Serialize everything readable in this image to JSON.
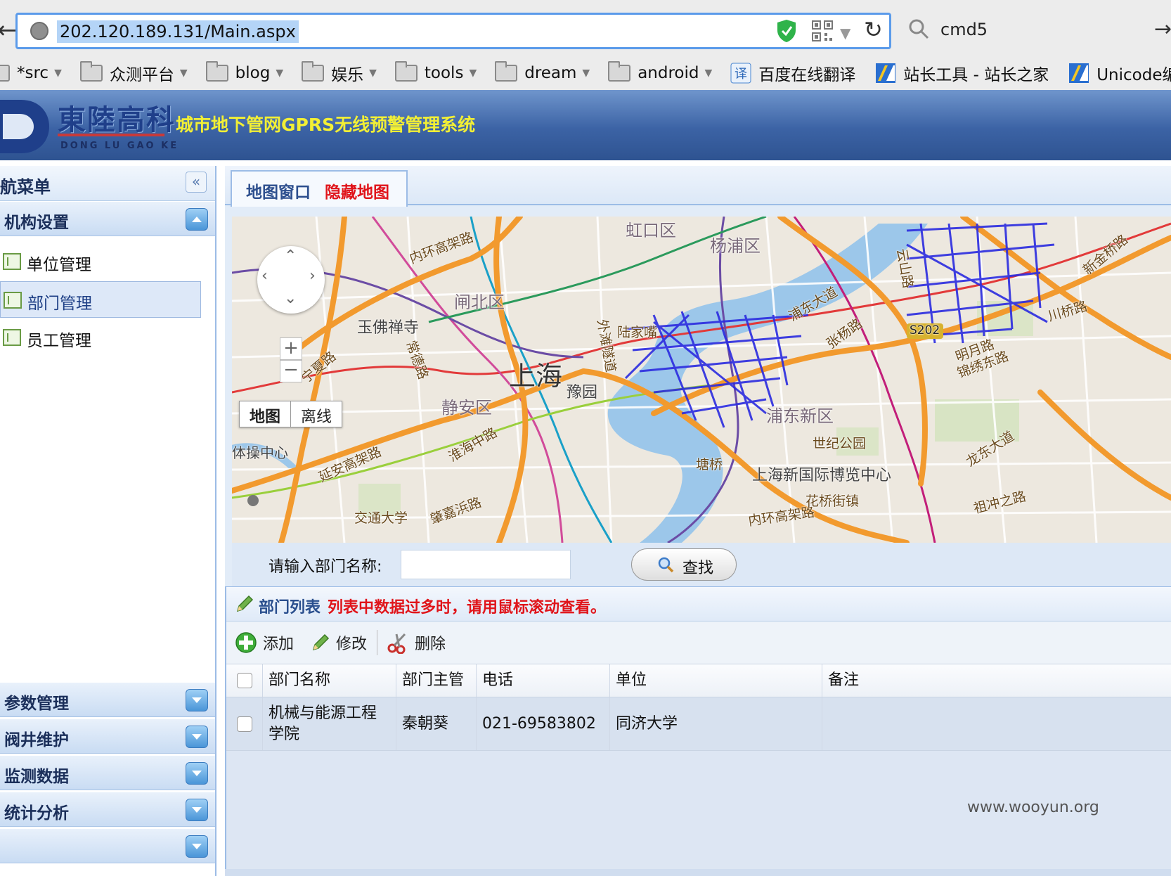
{
  "browser": {
    "url": "202.120.189.131/Main.aspx",
    "search_query": "cmd5",
    "bookmarks": [
      {
        "label": "*src",
        "type": "folder"
      },
      {
        "label": "众测平台",
        "type": "folder"
      },
      {
        "label": "blog",
        "type": "folder"
      },
      {
        "label": "娱乐",
        "type": "folder"
      },
      {
        "label": "tools",
        "type": "folder"
      },
      {
        "label": "dream",
        "type": "folder"
      },
      {
        "label": "android",
        "type": "folder"
      },
      {
        "label": "百度在线翻译",
        "type": "site"
      },
      {
        "label": "站长工具 - 站长之家",
        "type": "site"
      },
      {
        "label": "Unicode编",
        "type": "site"
      }
    ]
  },
  "header": {
    "logo_cn": "東陸高科",
    "logo_en": "DONG LU GAO KE",
    "system_title": "城市地下管网GPRS无线预警管理系统",
    "colors": {
      "title": "#f2ef35",
      "bar": "#3c63a5"
    }
  },
  "sidebar": {
    "title": "航菜单",
    "sections": [
      {
        "label": "机构设置",
        "expanded": true,
        "items": [
          {
            "label": "单位管理",
            "selected": false
          },
          {
            "label": "部门管理",
            "selected": true
          },
          {
            "label": "员工管理",
            "selected": false
          }
        ]
      },
      {
        "label": "参数管理",
        "expanded": false
      },
      {
        "label": "阀井维护",
        "expanded": false
      },
      {
        "label": "监测数据",
        "expanded": false
      },
      {
        "label": "统计分析",
        "expanded": false
      }
    ]
  },
  "tab": {
    "label": "地图窗口",
    "hide_map": "隐藏地图"
  },
  "map": {
    "labels": {
      "shanghai": "上海",
      "yangpu": "杨浦区",
      "zhabei": "闸北区",
      "jingan": "静安区",
      "pudong": "浦东新区",
      "yuyuan": "豫园",
      "yufo": "玉佛禅寺",
      "hongkou": "虹口区",
      "expo": "上海新国际博览中心",
      "century_park": "世纪公园",
      "neihuan1": "内环高架路",
      "neihuan2": "内环高架路",
      "yanan": "延安高架路",
      "huaihai": "淮海中路",
      "changde": "常德路",
      "waitan": "外滩隧道",
      "pudong_ave": "浦东大道",
      "zhangyang": "张杨路",
      "longdong": "龙东大道",
      "zuchongzhi": "祖冲之路",
      "jinxiu": "锦绣东路",
      "chuanqiao": "川桥路",
      "s202": "S202",
      "tiyu": "体操中心",
      "jiaoda": "交通大学",
      "zhaojiabang": "肇嘉浜路",
      "huaqiao": "花桥街镇",
      "tangqiao": "塘桥",
      "minghang": "明月路",
      "lujiazui": "陆家嘴",
      "xinjinqiao": "新金桥路",
      "yunshan": "云山路",
      "changning": "宁夏路"
    },
    "type_buttons": [
      "地图",
      "离线"
    ]
  },
  "search": {
    "label": "请输入部门名称:",
    "input_value": "",
    "button": "查找"
  },
  "list": {
    "title": "部门列表",
    "hint": "列表中数据过多时，请用鼠标滚动查看。",
    "toolbar": {
      "add": "添加",
      "edit": "修改",
      "delete": "删除"
    },
    "columns": [
      "部门名称",
      "部门主管",
      "电话",
      "单位",
      "备注"
    ],
    "rows": [
      {
        "name": "机械与能源工程学院",
        "manager": "秦朝葵",
        "phone": "021-69583802",
        "unit": "同济大学",
        "remark": ""
      }
    ]
  },
  "watermark": "www.wooyun.org"
}
